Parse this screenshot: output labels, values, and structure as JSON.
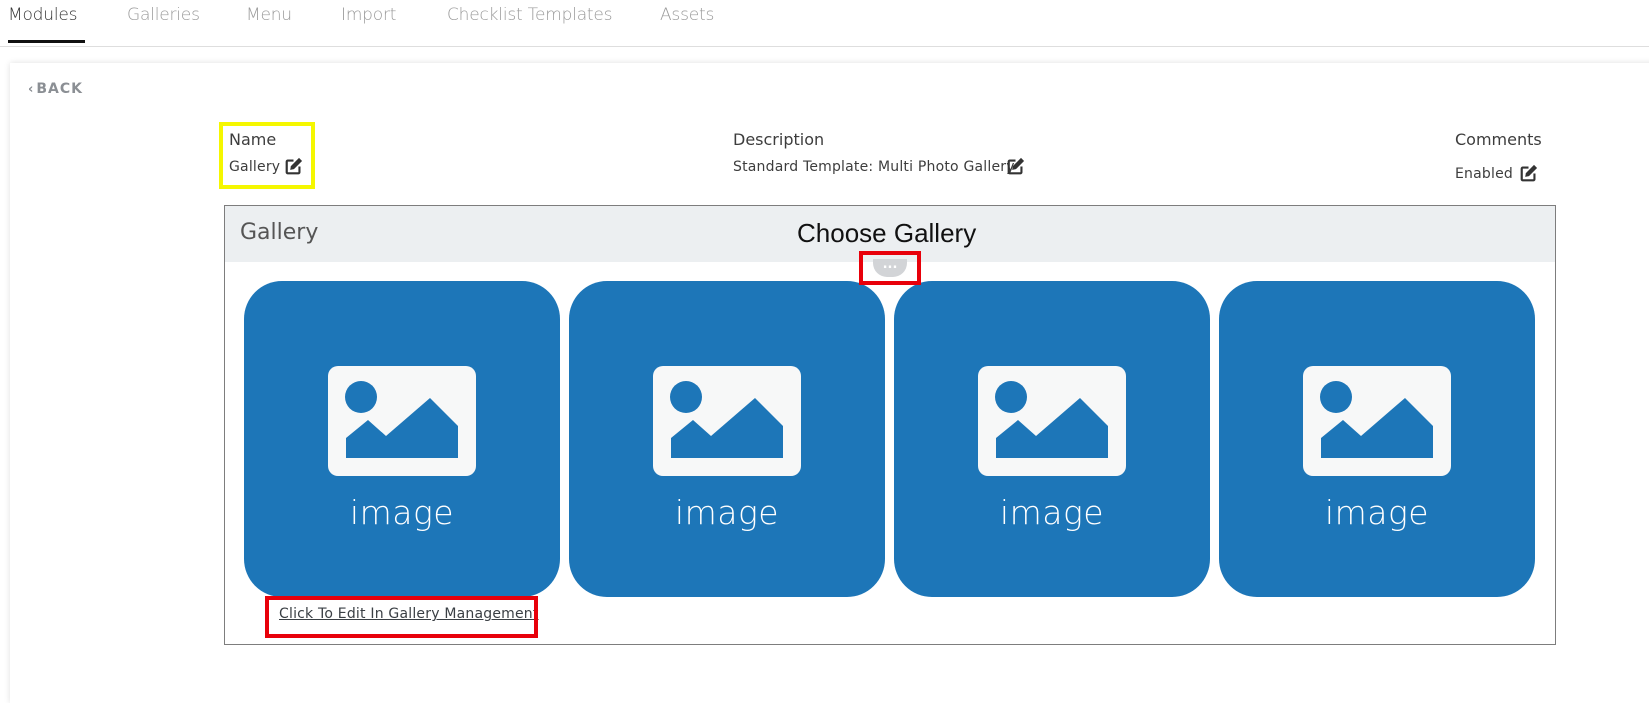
{
  "tabs": [
    {
      "label": "Modules",
      "active": true
    },
    {
      "label": "Galleries",
      "active": false
    },
    {
      "label": "Menu",
      "active": false
    },
    {
      "label": "Import",
      "active": false
    },
    {
      "label": "Checklist Templates",
      "active": false
    },
    {
      "label": "Assets",
      "active": false
    }
  ],
  "back_label": "BACK",
  "fields": {
    "name": {
      "label": "Name",
      "value": "Gallery"
    },
    "description": {
      "label": "Description",
      "value": "Standard Template: Multi Photo Gallery"
    },
    "comments": {
      "label": "Comments",
      "value": "Enabled"
    }
  },
  "gallery": {
    "title": "Gallery",
    "choose_label": "Choose Gallery",
    "more_label": "...",
    "tiles": [
      {
        "caption": "image"
      },
      {
        "caption": "image"
      },
      {
        "caption": "image"
      },
      {
        "caption": "image"
      }
    ],
    "edit_link": "Click To Edit In Gallery Management"
  },
  "colors": {
    "tile_blue": "#1d76b8",
    "highlight_yellow": "#f5f700",
    "highlight_red": "#e8000a",
    "header_gray": "#eceff1"
  },
  "icons": {
    "edit": "edit-square-icon",
    "placeholder": "image-placeholder-icon",
    "back": "chevron-left-icon"
  }
}
